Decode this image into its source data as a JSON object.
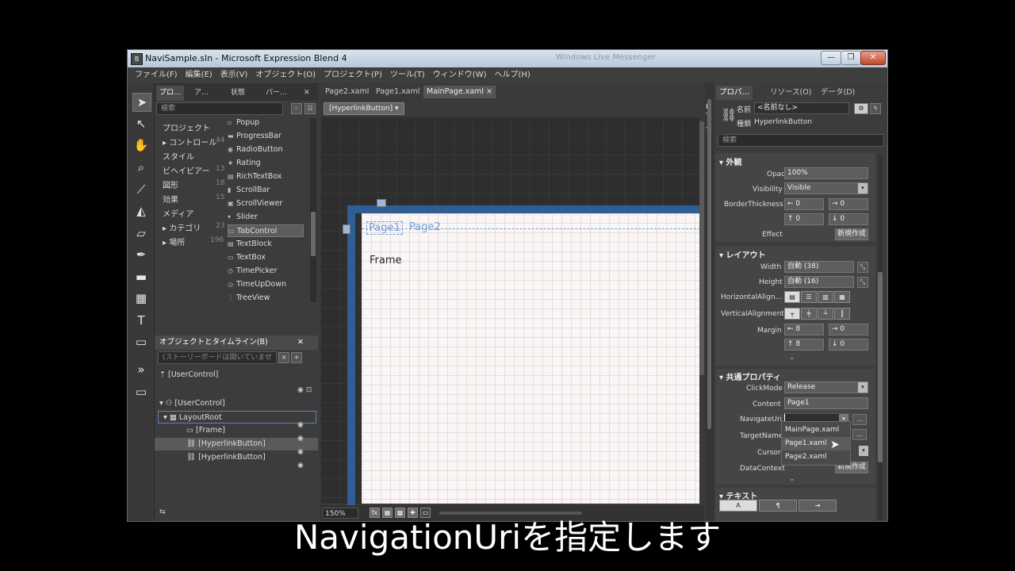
{
  "window": {
    "title": "NaviSample.sln - Microsoft Expression Blend 4",
    "ghost_title": "Windows Live Messenger",
    "min": "—",
    "max": "❐",
    "close": "✕"
  },
  "menu": [
    "ファイル(F)",
    "編集(E)",
    "表示(V)",
    "オブジェクト(O)",
    "プロジェクト(P)",
    "ツール(T)",
    "ウィンドウ(W)",
    "ヘルプ(H)"
  ],
  "left_panel": {
    "tabs": [
      "プロ…",
      "ア…",
      "状態",
      "パー…"
    ],
    "search_placeholder": "検索",
    "categories": [
      {
        "label": "プロジェクト",
        "count": ""
      },
      {
        "label": "▸ コントロール",
        "count": "44"
      },
      {
        "label": "スタイル",
        "count": ""
      },
      {
        "label": "ビヘイビアー",
        "count": "13"
      },
      {
        "label": "図形",
        "count": "18"
      },
      {
        "label": "効果",
        "count": "15"
      },
      {
        "label": "メディア",
        "count": ""
      },
      {
        "label": "▸ カテゴリ",
        "count": "23"
      },
      {
        "label": "▸ 場所",
        "count": "196"
      }
    ],
    "controls": [
      "Popup",
      "ProgressBar",
      "RadioButton",
      "Rating",
      "RichTextBox",
      "ScrollBar",
      "ScrollViewer",
      "Slider",
      "TabControl",
      "TextBlock",
      "TextBox",
      "TimePicker",
      "TimeUpDown",
      "TreeView"
    ],
    "objects_header": "オブジェクトとタイムライン(B)",
    "storyboard": "(ストーリーボードは開いていませ",
    "usercontrol_top": "[UserControl]",
    "tree": [
      {
        "label": "[UserControl]",
        "indent": 0
      },
      {
        "label": "LayoutRoot",
        "indent": 1
      },
      {
        "label": "[Frame]",
        "indent": 2
      },
      {
        "label": "[HyperlinkButton]",
        "indent": 2
      },
      {
        "label": "[HyperlinkButton]",
        "indent": 2
      }
    ]
  },
  "document": {
    "tabs": [
      "Page2.xaml",
      "Page1.xaml",
      "MainPage.xaml ×"
    ],
    "breadcrumb": "[HyperlinkButton] ▾",
    "link1": "Page1",
    "link2": "Page2",
    "frame_label": "Frame",
    "zoom": "150%"
  },
  "right_panel": {
    "tabs": [
      "プロパ…",
      "リソース(O)",
      "データ(D)"
    ],
    "name_label": "名前",
    "name_value": "<名前なし>",
    "type_label": "種類",
    "type_value": "HyperlinkButton",
    "search_placeholder": "検索",
    "appearance": {
      "header": "▾ 外観",
      "opacity_label": "Opacity",
      "opacity_value": "100%",
      "visibility_label": "Visibility",
      "visibility_value": "Visible",
      "border_label": "BorderThickness",
      "bt_left": "0",
      "bt_right": "0",
      "bt_top": "0",
      "bt_bottom": "0",
      "effect_label": "Effect",
      "effect_button": "新規作成"
    },
    "layout": {
      "header": "▾ レイアウト",
      "width_label": "Width",
      "width_value": "自動 (38)",
      "height_label": "Height",
      "height_value": "自動 (16)",
      "halign_label": "HorizontalAlign…",
      "valign_label": "VerticalAlignment",
      "margin_label": "Margin",
      "m_left": "8",
      "m_right": "0",
      "m_top": "8",
      "m_bottom": "0"
    },
    "common": {
      "header": "▾ 共通プロパティ",
      "clickmode_label": "ClickMode",
      "clickmode_value": "Release",
      "content_label": "Content",
      "content_value": "Page1",
      "navuri_label": "NavigateUri",
      "navuri_value": "",
      "targetname_label": "TargetName",
      "cursor_label": "Cursor",
      "datacontext_label": "DataContext",
      "datacontext_button": "新規作成"
    },
    "uri_options": [
      "MainPage.xaml",
      "Page1.xaml",
      "Page2.xaml"
    ],
    "text": {
      "header": "▾ テキスト"
    }
  },
  "subtitle": "NavigationUriを指定します"
}
